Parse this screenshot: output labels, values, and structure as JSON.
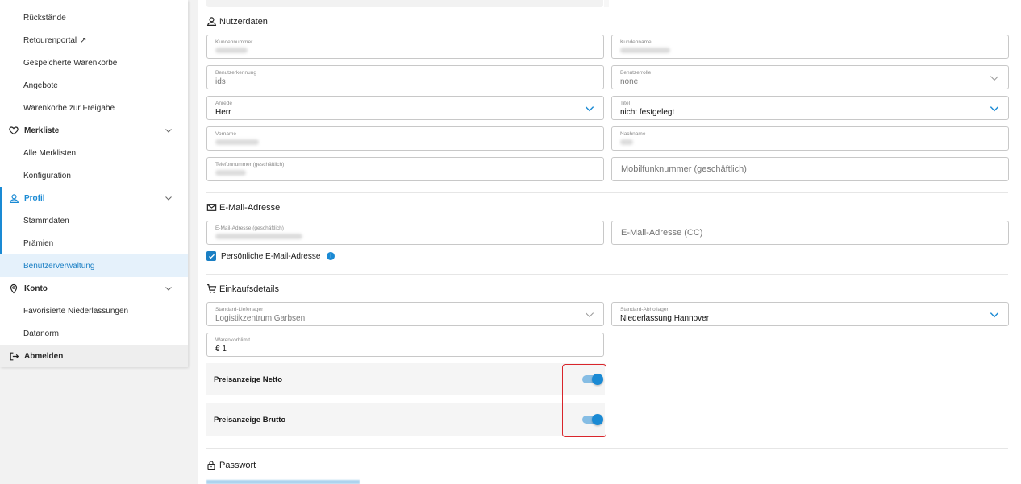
{
  "sidebar": {
    "items": [
      {
        "label": "Rückstände"
      },
      {
        "label": "Retourenportal",
        "external_icon": "↗"
      },
      {
        "label": "Gespeicherte Warenkörbe"
      },
      {
        "label": "Angebote"
      },
      {
        "label": "Warenkörbe zur Freigabe"
      },
      {
        "label": "Merkliste"
      },
      {
        "label": "Alle Merklisten"
      },
      {
        "label": "Konfiguration"
      },
      {
        "label": "Profil"
      },
      {
        "label": "Stammdaten"
      },
      {
        "label": "Prämien"
      },
      {
        "label": "Benutzerverwaltung"
      },
      {
        "label": "Konto"
      },
      {
        "label": "Favorisierte Niederlassungen"
      },
      {
        "label": "Datanorm"
      },
      {
        "label": "Abmelden"
      }
    ]
  },
  "sections": {
    "nutzerdaten": "Nutzerdaten",
    "email": "E-Mail-Adresse",
    "einkauf": "Einkaufsdetails",
    "passwort": "Passwort"
  },
  "fields": {
    "kundennummer": {
      "label": "Kundennummer",
      "value": ""
    },
    "kundenname": {
      "label": "Kundenname",
      "value": ""
    },
    "benutzerkennung": {
      "label": "Benutzerkennung",
      "value": "ids"
    },
    "benutzerrolle": {
      "label": "Benutzerrolle",
      "value": "none"
    },
    "anrede": {
      "label": "Anrede",
      "value": "Herr"
    },
    "titel": {
      "label": "Titel",
      "value": "nicht festgelegt"
    },
    "vorname": {
      "label": "Vorname",
      "value": ""
    },
    "nachname": {
      "label": "Nachname",
      "value": ""
    },
    "telefon": {
      "label": "Telefonnummer (geschäftlich)",
      "value": ""
    },
    "mobil": {
      "placeholder": "Mobilfunknummer (geschäftlich)"
    },
    "email_geschaeftlich": {
      "label": "E-Mail-Adresse (geschäftlich)",
      "value": ""
    },
    "email_cc": {
      "placeholder": "E-Mail-Adresse (CC)"
    },
    "lieferlager": {
      "label": "Standard-Lieferlager",
      "value": "Logistikzentrum Garbsen"
    },
    "abhollager": {
      "label": "Standard-Abhollager",
      "value": "Niederlassung Hannover"
    },
    "warenkorblimit": {
      "label": "Warenkorblimit",
      "value": "€ 1"
    }
  },
  "checkbox": {
    "label": "Persönliche E-Mail-Adresse",
    "checked": true,
    "info_icon": "i"
  },
  "toggles": [
    {
      "label": "Preisanzeige Netto",
      "on": true
    },
    {
      "label": "Preisanzeige Brutto",
      "on": true
    }
  ],
  "colors": {
    "accent": "#1a8ad4",
    "highlight_border": "#d9252b"
  }
}
